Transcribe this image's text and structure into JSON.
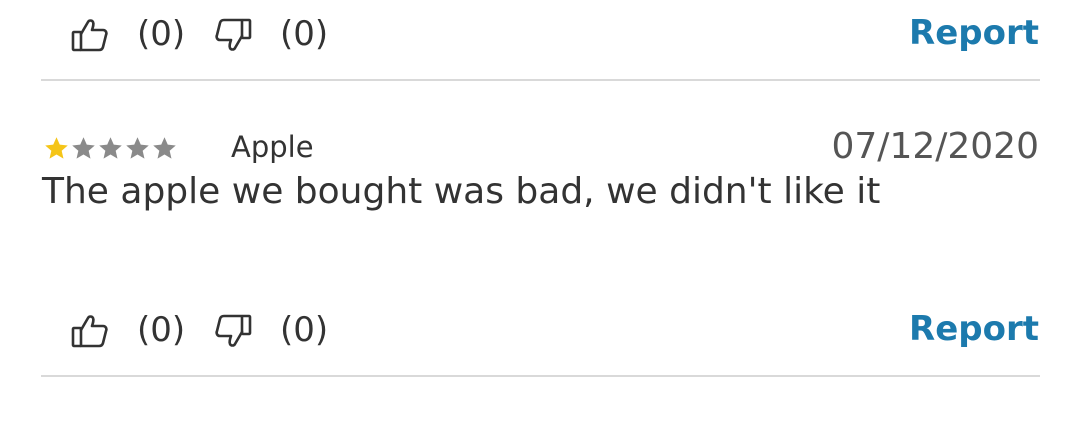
{
  "colors": {
    "accent": "#1c7aad",
    "star_filled": "#f5c518",
    "star_empty": "#8a8a8a",
    "divider": "#d9d9d9",
    "text": "#333333"
  },
  "top_votes": {
    "upvote_icon": "thumbs-up-icon",
    "upvote_count": "(0)",
    "downvote_icon": "thumbs-down-icon",
    "downvote_count": "(0)",
    "report_label": "Report"
  },
  "review": {
    "rating": 1,
    "rating_max": 5,
    "product": "Apple",
    "date": "07/12/2020",
    "text": "The apple we bought was bad, we didn't like it",
    "votes": {
      "upvote_icon": "thumbs-up-icon",
      "upvote_count": "(0)",
      "downvote_icon": "thumbs-down-icon",
      "downvote_count": "(0)",
      "report_label": "Report"
    }
  }
}
